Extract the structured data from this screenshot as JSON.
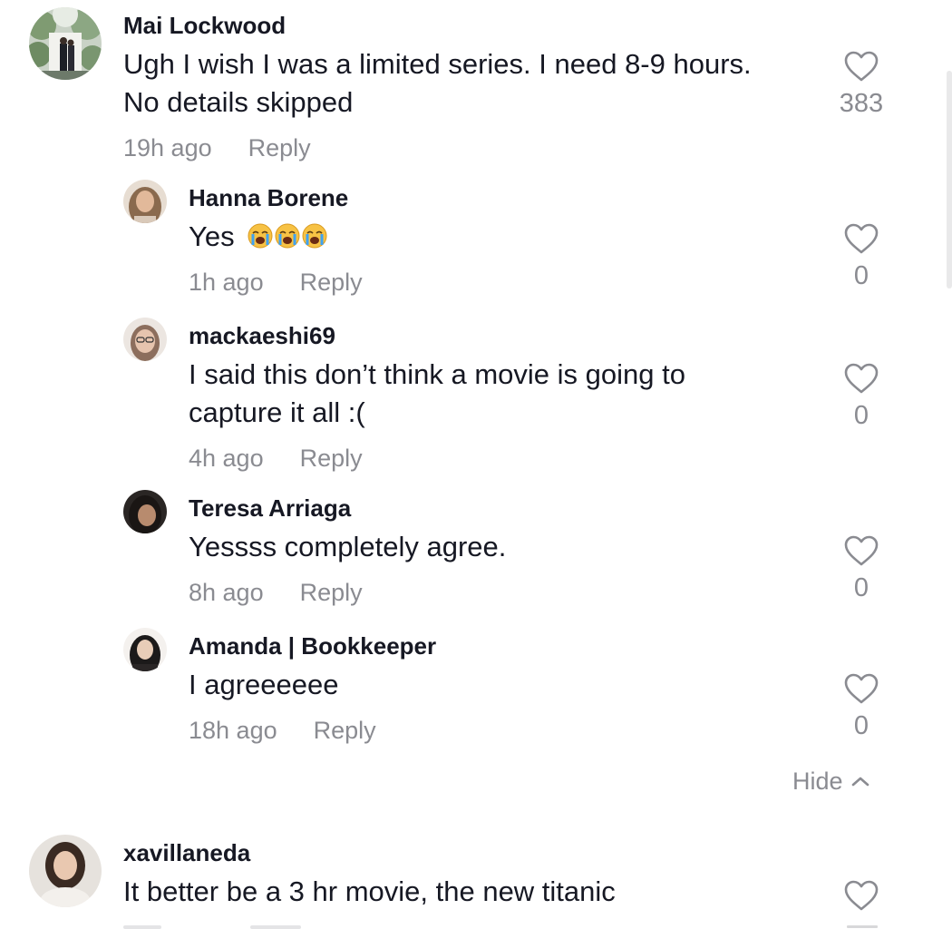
{
  "comments": [
    {
      "username": "Mai Lockwood",
      "text_lines": [
        "Ugh I wish I was a limited series. I need 8-9 hours.",
        "No details skipped"
      ],
      "time": "19h ago",
      "reply_label": "Reply",
      "likes": "383",
      "icon": "heart-outline-icon"
    }
  ],
  "replies": [
    {
      "username": "Hanna Borene",
      "text": "Yes",
      "emoji": [
        "loudly-crying-face",
        "loudly-crying-face",
        "loudly-crying-face"
      ],
      "time": "1h ago",
      "reply_label": "Reply",
      "likes": "0"
    },
    {
      "username": "mackaeshi69",
      "text_lines": [
        "I said this don’t think a movie is going to",
        "capture it all :("
      ],
      "time": "4h ago",
      "reply_label": "Reply",
      "likes": "0"
    },
    {
      "username": "Teresa Arriaga",
      "text": "Yessss completely agree.",
      "time": "8h ago",
      "reply_label": "Reply",
      "likes": "0"
    },
    {
      "username": "Amanda | Bookkeeper",
      "text": "I agreeeeee",
      "time": "18h ago",
      "reply_label": "Reply",
      "likes": "0"
    }
  ],
  "hide_label": "Hide",
  "next_comment": {
    "username": "xavillaneda",
    "text": "It better be a 3 hr movie, the new titanic"
  },
  "colors": {
    "text_primary": "#161823",
    "text_secondary": "#8a8b91",
    "icon_stroke": "#8a8b91",
    "emoji_yellow": "#f7c244",
    "emoji_tear": "#3fa2f2"
  }
}
